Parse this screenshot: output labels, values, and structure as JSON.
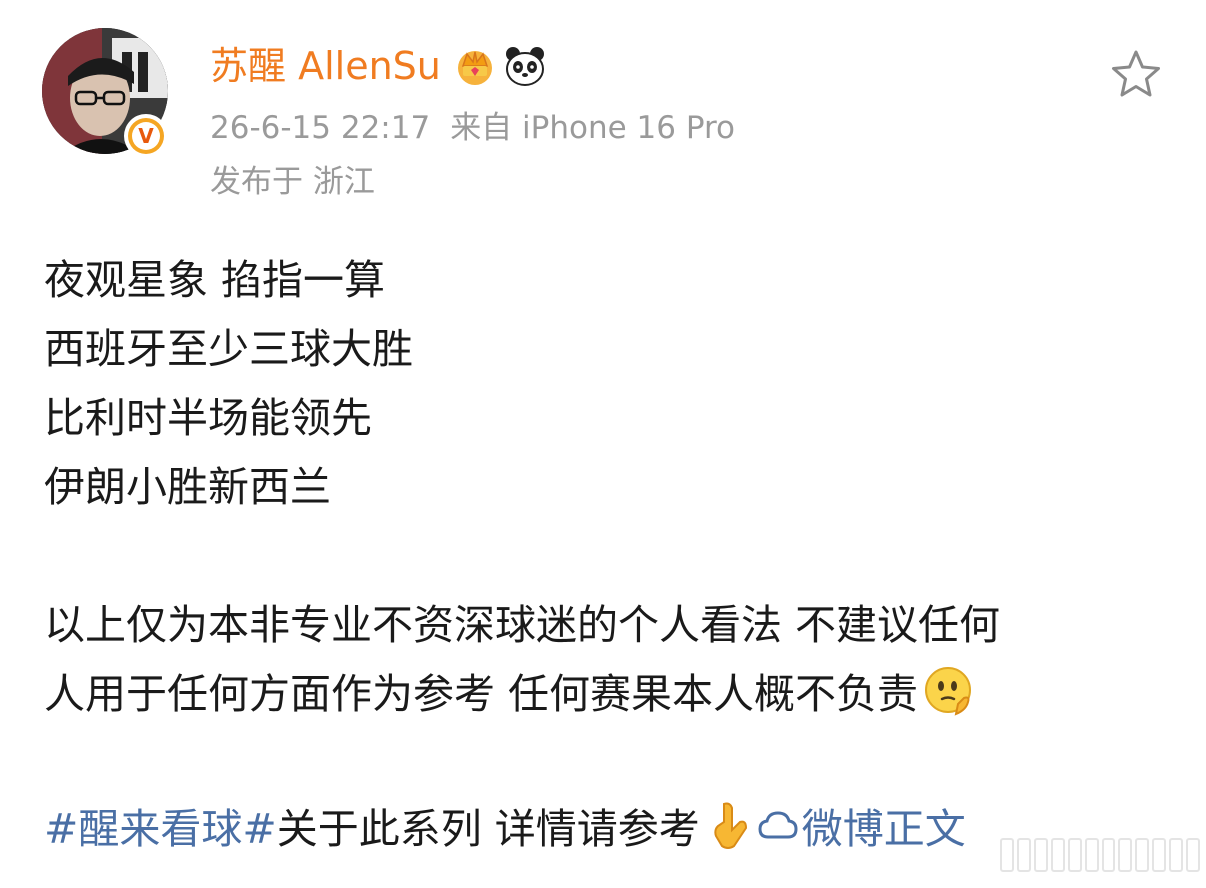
{
  "header": {
    "username": "苏醒 AllenSu",
    "timestamp": "26-6-15 22:17",
    "source": "来自 iPhone 16 Pro",
    "location": "发布于 浙江"
  },
  "badges": [
    "crown-icon",
    "panda-icon"
  ],
  "verified_mark": "V",
  "post": {
    "lines": [
      "夜观星象 掐指一算",
      "西班牙至少三球大胜",
      "比利时半场能领先",
      "伊朗小胜新西兰"
    ],
    "disclaimer_1": "以上仅为本非专业不资深球迷的个人看法 不建议任何",
    "disclaimer_2": "人用于任何方面作为参考 任何赛果本人概不负责",
    "hashtag": "#醒来看球#",
    "hashtag_tail": "关于此系列 详情请参考",
    "weibo_link": "微博正文"
  },
  "colors": {
    "username": "#f07c21",
    "meta": "#9a9a9a",
    "link": "#4a6fa5",
    "text": "#1a1a1a"
  }
}
